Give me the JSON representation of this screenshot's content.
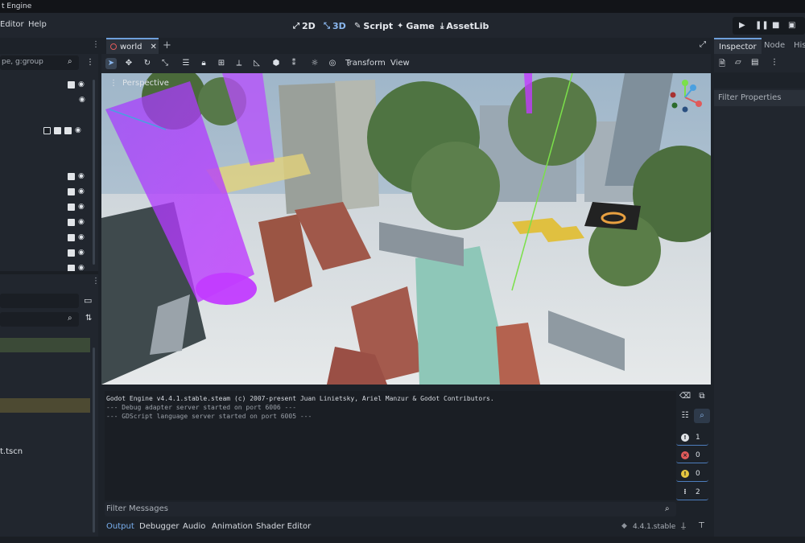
{
  "window": {
    "title": "t Engine"
  },
  "menu": {
    "editor": "Editor",
    "help": "Help"
  },
  "workspaces": [
    {
      "label": "2D",
      "icon": "2d-icon"
    },
    {
      "label": "3D",
      "icon": "3d-icon"
    },
    {
      "label": "Script",
      "icon": "script-icon"
    },
    {
      "label": "Game",
      "icon": "game-icon"
    },
    {
      "label": "AssetLib",
      "icon": "assetlib-icon"
    }
  ],
  "scene_dock": {
    "filter_placeholder": "pe, g:group"
  },
  "filesystem": {
    "file_label": "t.tscn"
  },
  "scene_tab": {
    "name": "world"
  },
  "toolbar": {
    "transform": "Transform",
    "view": "View"
  },
  "viewport": {
    "mode": "Perspective"
  },
  "output": {
    "lines": [
      "Godot Engine v4.4.1.stable.steam (c) 2007-present Juan Linietsky, Ariel Manzur & Godot Contributors.",
      "--- Debug adapter server started on port 6006 ---",
      "--- GDScript language server started on port 6005 ---"
    ],
    "filter_placeholder": "Filter Messages",
    "counts": {
      "messages": "1",
      "errors": "0",
      "warnings": "0",
      "info": "2"
    },
    "version": "4.4.1.stable"
  },
  "bottom_tabs": [
    "Output",
    "Debugger",
    "Audio",
    "Animation",
    "Shader Editor"
  ],
  "inspector": {
    "tabs": [
      "Inspector",
      "Node",
      "His"
    ],
    "filter_placeholder": "Filter Properties"
  },
  "colors": {
    "accent": "#6e9fdb",
    "panel": "#21262e",
    "background": "#1d2229"
  }
}
